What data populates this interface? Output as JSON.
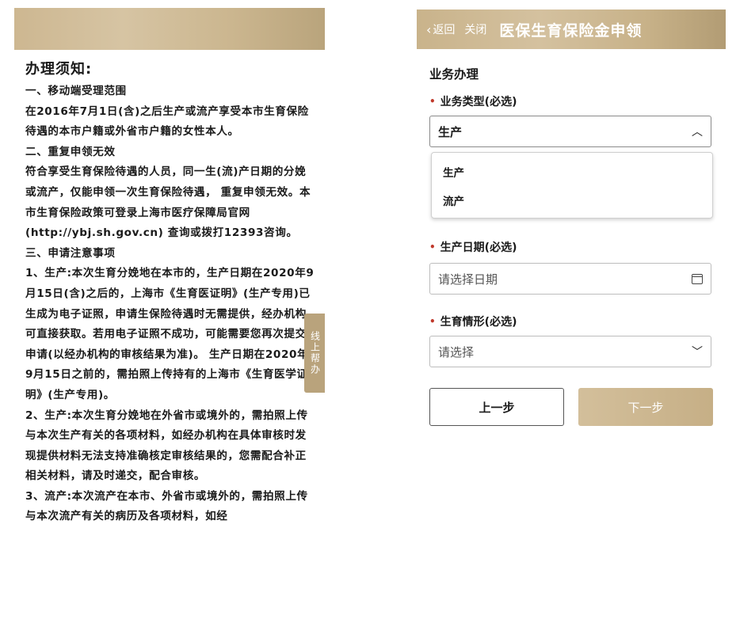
{
  "notice": {
    "title": "办理须知:",
    "paragraphs": [
      "一、移动端受理范围",
      "在2016年7月1日(含)之后生产或流产享受本市生育保险待遇的本市户籍或外省市户籍的女性本人。",
      "二、重复申领无效",
      "符合享受生育保险待遇的人员，同一生(流)产日期的分娩或流产，仅能申领一次生育保险待遇， 重复申领无效。本市生育保险政策可登录上海市医疗保障局官网 (http://ybj.sh.gov.cn) 查询或拨打12393咨询。",
      "三、申请注意事项",
      "1、生产:本次生育分娩地在本市的，生产日期在2020年9月15日(含)之后的，上海市《生育医证明》(生产专用)已生成为电子证照，申请生保险待遇时无需提供，经办机构可直接获取。若用电子证照不成功，可能需要您再次提交申请(以经办机构的审核结果为准)。 生产日期在2020年9月15日之前的，需拍照上传持有的上海市《生育医学证明》(生产专用)。",
      "2、生产:本次生育分娩地在外省市或境外的，需拍照上传与本次生产有关的各项材料，如经办机构在具体审核时发现提供材料无法支持准确核定审核结果的，您需配合补正相关材料，请及时递交，配合审核。",
      "3、流产:本次流产在本市、外省市或境外的，需拍照上传与本次流产有关的病历及各项材料，如经"
    ],
    "side_tab": "线上帮办"
  },
  "header": {
    "back_label": "返回",
    "close_label": "关闭",
    "title": "医保生育保险金申领"
  },
  "form": {
    "section_title": "业务办理",
    "business_type": {
      "label": "业务类型(必选)",
      "value": "生产",
      "options": [
        "生产",
        "流产"
      ]
    },
    "birth_date": {
      "label": "生产日期(必选)",
      "placeholder": "请选择日期"
    },
    "birth_situation": {
      "label": "生育情形(必选)",
      "placeholder": "请选择"
    }
  },
  "buttons": {
    "prev": "上一步",
    "next": "下一步"
  },
  "colors": {
    "header_gold": "#c9b38b",
    "required_dot": "#c0392b",
    "next_button": "#c6af86"
  }
}
